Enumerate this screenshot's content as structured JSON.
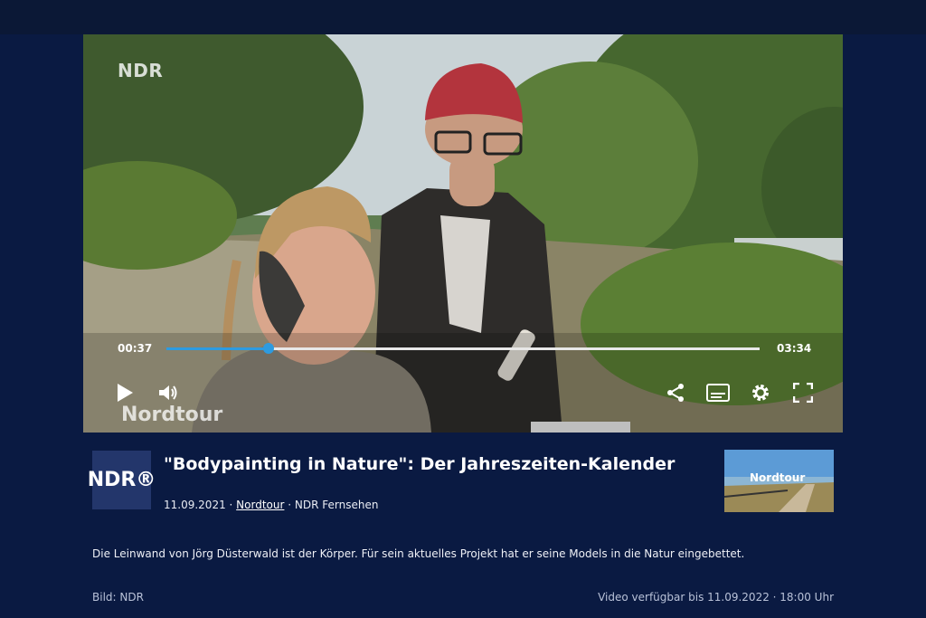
{
  "player": {
    "channel_logo": "NDR",
    "show_watermark": "Nordtour",
    "current_time": "00:37",
    "duration": "03:34",
    "progress": 0.173,
    "controls": {
      "play": "play-icon",
      "volume": "volume-icon",
      "share": "share-icon",
      "subtitles": "subtitles-icon",
      "settings": "gear-icon",
      "fullscreen": "fullscreen-icon"
    },
    "accent_color": "#2d9be0"
  },
  "info": {
    "logo": "NDR®",
    "title": "\"Bodypainting in Nature\": Der Jahreszeiten-Kalender",
    "date": "11.09.2021",
    "sep1": " · ",
    "show": "Nordtour",
    "sep2": " · ",
    "channel": "NDR Fernsehen",
    "thumbnail_logo": "Nordtour",
    "description": "Die Leinwand von Jörg Düsterwald ist der Körper. Für sein aktuelles Projekt hat er seine Models in die Natur eingebettet.",
    "credit": "Bild: NDR",
    "availability": "Video verfügbar bis 11.09.2022 · 18:00 Uhr"
  },
  "colors": {
    "background": "#0a1a42",
    "logo_box": "#23366b"
  }
}
